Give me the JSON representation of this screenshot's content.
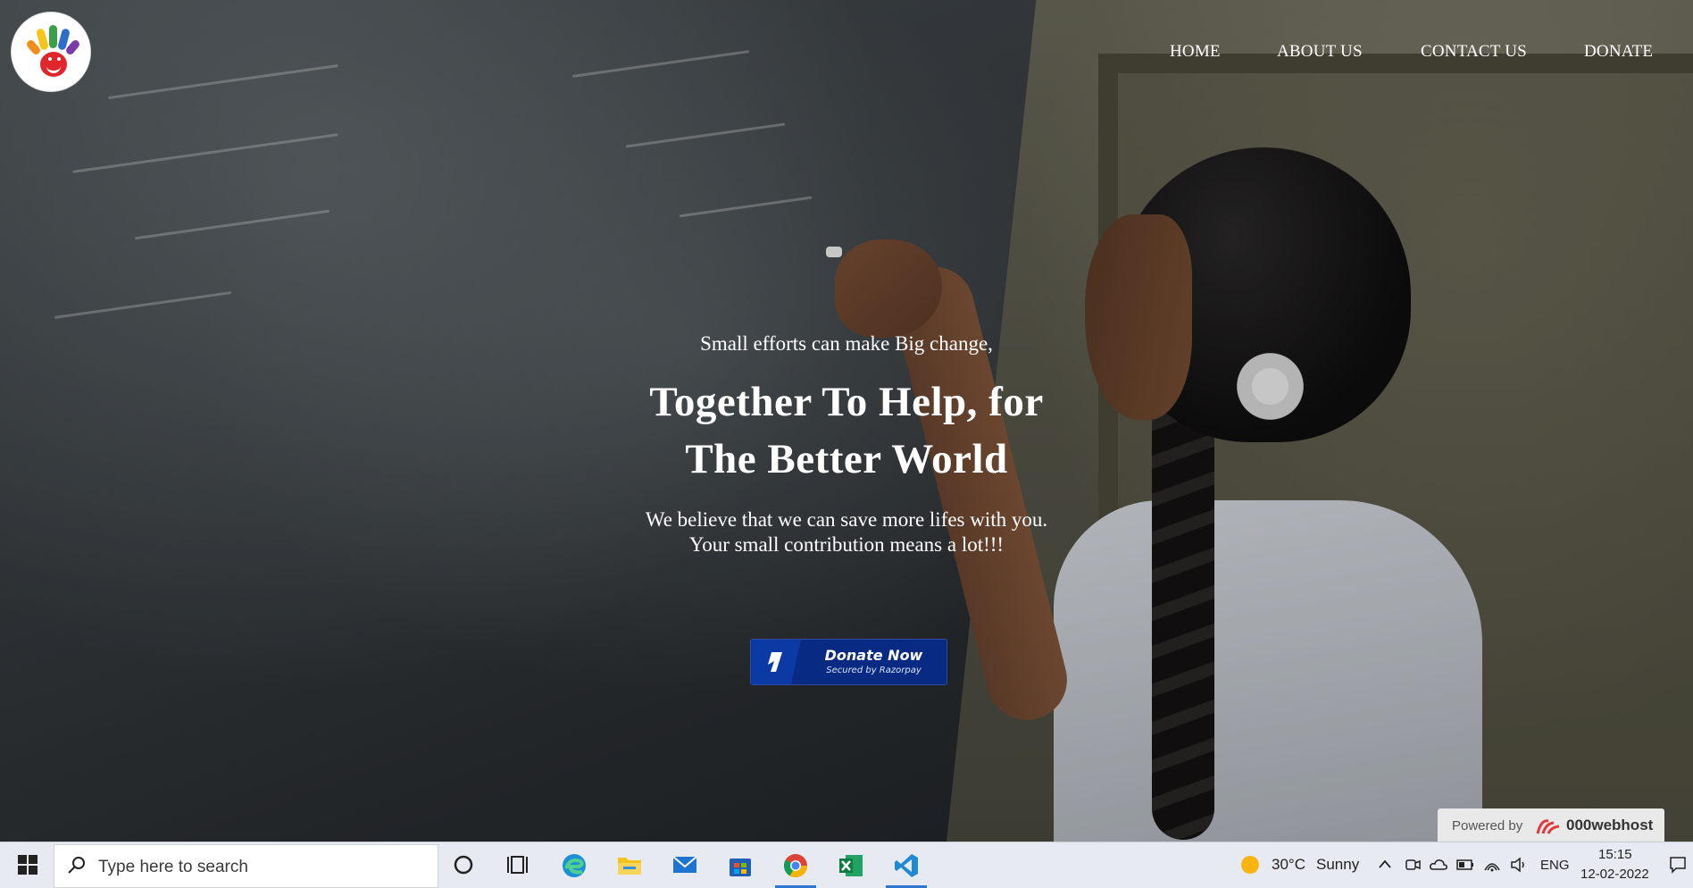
{
  "nav": {
    "items": [
      {
        "label": "HOME"
      },
      {
        "label": "ABOUT US"
      },
      {
        "label": "CONTACT US"
      },
      {
        "label": "DONATE"
      }
    ]
  },
  "hero": {
    "tagline": "Small efforts can make Big change,",
    "headline_line1": "Together To Help, for",
    "headline_line2": "The Better World",
    "sub_line1": "We believe that we can save more lifes with you.",
    "sub_line2": "Your small contribution means a lot!!!"
  },
  "donate_button": {
    "title": "Donate Now",
    "subtitle": "Secured by Razorpay",
    "color": "#082a82"
  },
  "powered_badge": {
    "label": "Powered by",
    "name": "000webhost"
  },
  "taskbar": {
    "search_placeholder": "Type here to search",
    "apps": [
      {
        "icon": "cortana-icon"
      },
      {
        "icon": "task-view-icon"
      },
      {
        "icon": "edge-icon"
      },
      {
        "icon": "file-explorer-icon"
      },
      {
        "icon": "mail-icon"
      },
      {
        "icon": "store-icon"
      },
      {
        "icon": "chrome-icon",
        "active": true
      },
      {
        "icon": "excel-icon"
      },
      {
        "icon": "vscode-icon",
        "active": true
      }
    ],
    "weather": {
      "temp": "30°C",
      "condition": "Sunny"
    },
    "language": "ENG",
    "time": "15:15",
    "date": "12-02-2022"
  }
}
